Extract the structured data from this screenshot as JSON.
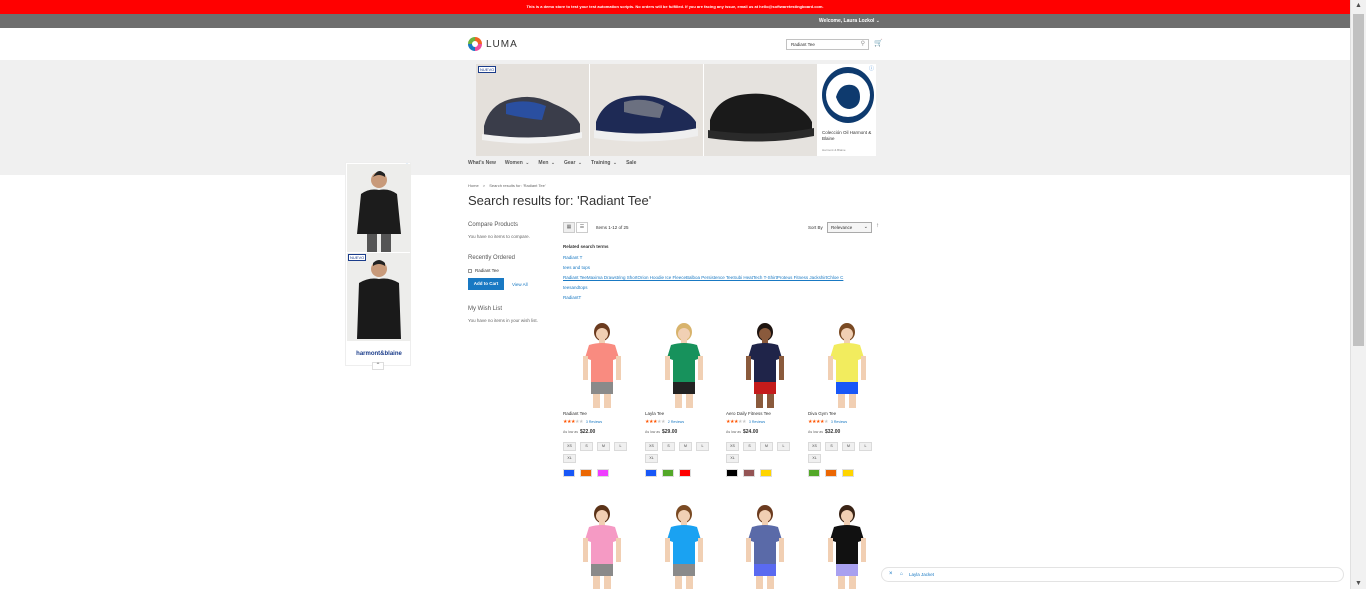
{
  "notice": "This is a demo store to test your test automation scripts. No orders will be fulfilled. If you are facing any issue, email us at hello@softwaretestingboard.com.",
  "header": {
    "welcome": "Welcome, Laura Lozkol",
    "logo_text": "LUMA",
    "search_value": "Radiant Tee"
  },
  "ad": {
    "badge": "NUEVO",
    "card_title": "Colección Oil Harmont & Blaine",
    "card_sub": "Harmont & Blaine"
  },
  "nav": [
    "What's New",
    "Women",
    "Men",
    "Gear",
    "Training",
    "Sale"
  ],
  "sky_ad": {
    "badge": "NUEVO",
    "brand": "harmont&blaine"
  },
  "breadcrumb": {
    "home": "Home",
    "sep": ">",
    "current": "Search results for: 'Radiant Tee'"
  },
  "title": "Search results for: 'Radiant Tee'",
  "sidebar": {
    "compare_title": "Compare Products",
    "compare_text": "You have no items to compare.",
    "recent_title": "Recently Ordered",
    "recent_item": "Radiant Tee",
    "add_to_cart": "Add to Cart",
    "view_all": "View All",
    "wishlist_title": "My Wish List",
    "wishlist_text": "You have no items in your wish list."
  },
  "toolbar": {
    "amount": "Items 1-12 of 25",
    "sort_label": "Sort By",
    "sort_value": "Relevance"
  },
  "related": {
    "title": "Related search terms",
    "terms": [
      "Radiant T",
      "tees and tops",
      "Radiant TeeMaxima Drawstring ShortOrion Hoodie Ice FleeceBalboa Persistence TeeSubi HeatTech T-ShirtProteus Fitness JackshirtChloe C",
      "teesandtops",
      "RadiantT"
    ]
  },
  "products": [
    {
      "name": "Radiant Tee",
      "rating": 3,
      "reviews": "3 Reviews",
      "as_low": "As low as",
      "price": "$22.00",
      "sizes": [
        "XS",
        "S",
        "M",
        "L",
        "XL"
      ],
      "colors": [
        "#1857f7",
        "#eb6703",
        "#ef3dff"
      ],
      "shirt": "#f98b80",
      "shorts": "#8a8a8a",
      "skin": "#f1cfb3",
      "hair": "#6b3b1f"
    },
    {
      "name": "Layla Tee",
      "rating": 3,
      "reviews": "2 Reviews",
      "as_low": "As low as",
      "price": "$29.00",
      "sizes": [
        "XS",
        "S",
        "M",
        "L",
        "XL"
      ],
      "colors": [
        "#1857f7",
        "#53a828",
        "#ff0000"
      ],
      "shirt": "#17925c",
      "shorts": "#222222",
      "skin": "#f1d0b4",
      "hair": "#d8b36c"
    },
    {
      "name": "Aero Daily Fitness Tee",
      "rating": 3,
      "reviews": "3 Reviews",
      "as_low": "As low as",
      "price": "$24.00",
      "sizes": [
        "XS",
        "S",
        "M",
        "L",
        "XL"
      ],
      "colors": [
        "#000000",
        "#945454",
        "#ffd500"
      ],
      "shirt": "#1f2449",
      "shorts": "#c41b1b",
      "skin": "#8a5a3c",
      "hair": "#1e1410"
    },
    {
      "name": "Diva Gym Tee",
      "rating": 4,
      "reviews": "3 Reviews",
      "as_low": "As low as",
      "price": "$32.00",
      "sizes": [
        "XS",
        "S",
        "M",
        "L",
        "XL"
      ],
      "colors": [
        "#53a828",
        "#eb6703",
        "#ffd500"
      ],
      "shirt": "#f2ec5e",
      "shorts": "#1857f7",
      "skin": "#f1cfb3",
      "hair": "#7a4a23"
    },
    {
      "name": "",
      "shirt": "#f59ac4",
      "shorts": "#8a8a8a",
      "skin": "#f1cfb3",
      "hair": "#5b3318"
    },
    {
      "name": "",
      "shirt": "#1aa2f2",
      "shorts": "#8a8a8a",
      "skin": "#f1d0b4",
      "hair": "#7a4a23"
    },
    {
      "name": "",
      "shirt": "#5a6aa8",
      "shorts": "#5a6af0",
      "skin": "#f1cfb3",
      "hair": "#6b3b1f"
    },
    {
      "name": "",
      "shirt": "#111111",
      "shorts": "#a8a0f0",
      "skin": "#f1cfb3",
      "hair": "#3a2416"
    }
  ],
  "chip": {
    "text": "Layla Jacket"
  }
}
